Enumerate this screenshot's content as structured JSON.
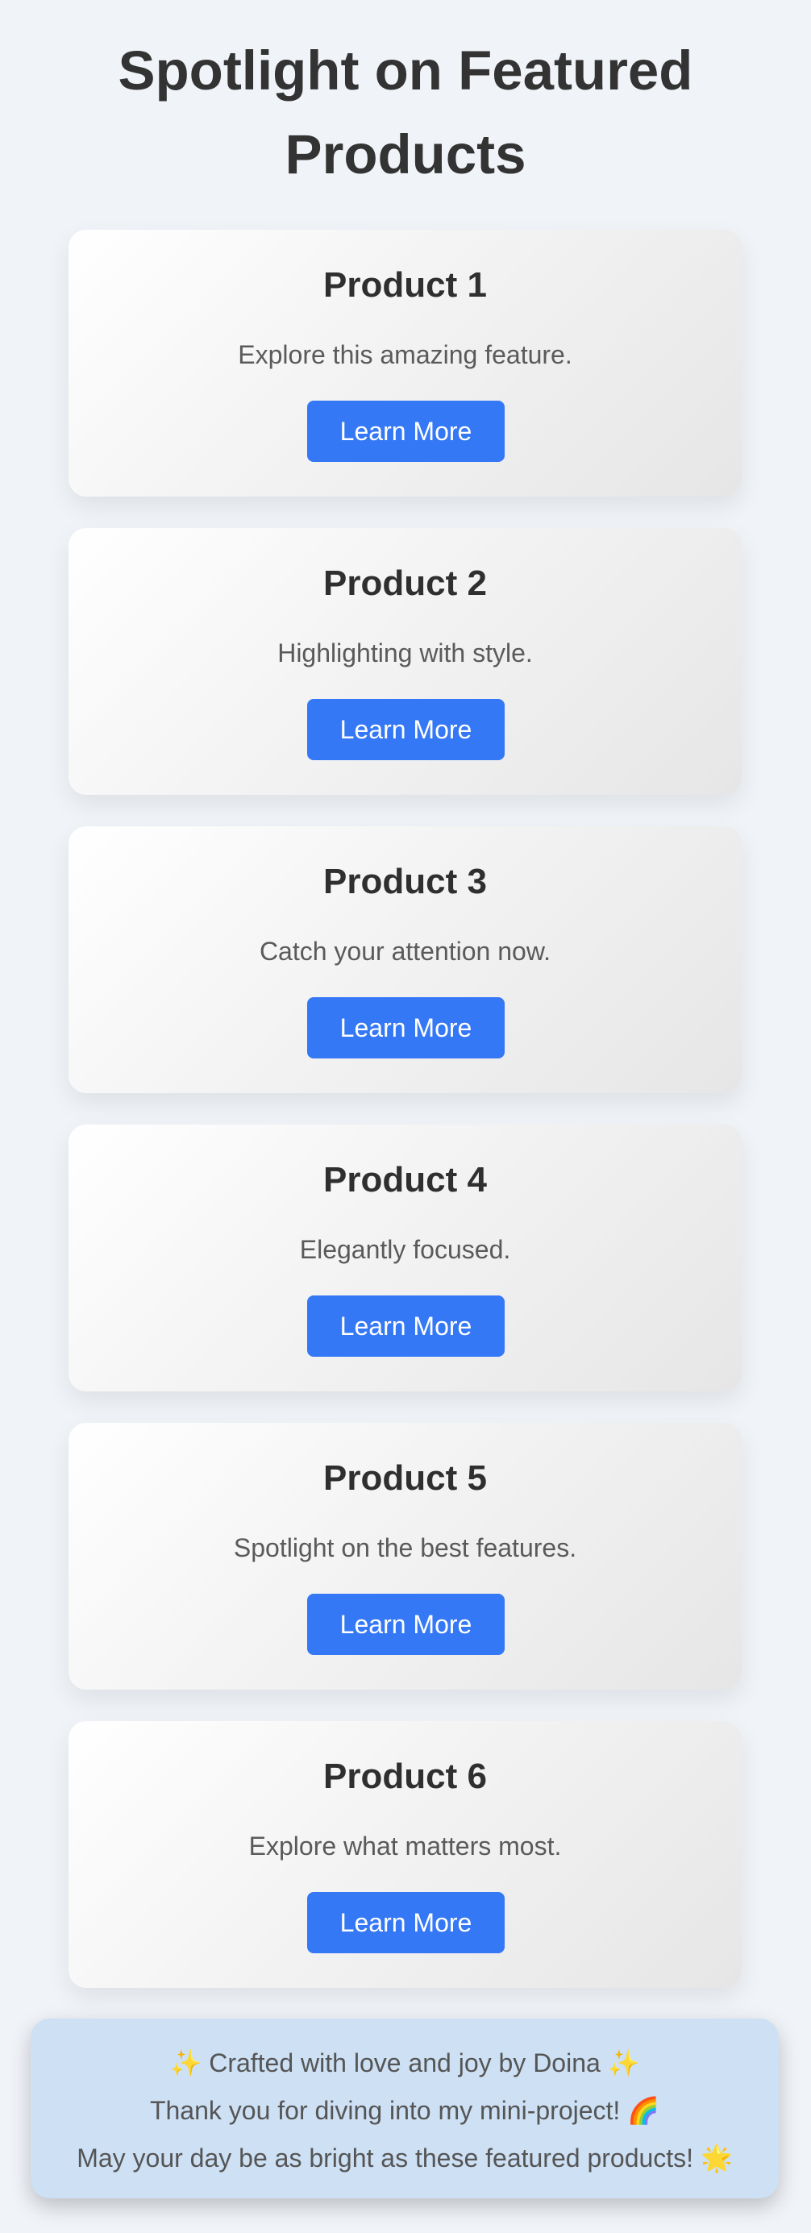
{
  "page": {
    "title": "Spotlight on Featured Products"
  },
  "products": [
    {
      "title": "Product 1",
      "description": "Explore this amazing feature.",
      "button": "Learn More"
    },
    {
      "title": "Product 2",
      "description": "Highlighting with style.",
      "button": "Learn More"
    },
    {
      "title": "Product 3",
      "description": "Catch your attention now.",
      "button": "Learn More"
    },
    {
      "title": "Product 4",
      "description": "Elegantly focused.",
      "button": "Learn More"
    },
    {
      "title": "Product 5",
      "description": "Spotlight on the best features.",
      "button": "Learn More"
    },
    {
      "title": "Product 6",
      "description": "Explore what matters most.",
      "button": "Learn More"
    }
  ],
  "footer": {
    "line1": "✨ Crafted with love and joy by Doina ✨",
    "line2": "Thank you for diving into my mini-project! 🌈",
    "line3": "May your day be as bright as these featured products! 🌟"
  },
  "colors": {
    "background": "#f0f3f8",
    "button": "#3478f6",
    "footer_background": "#cde0f4"
  }
}
